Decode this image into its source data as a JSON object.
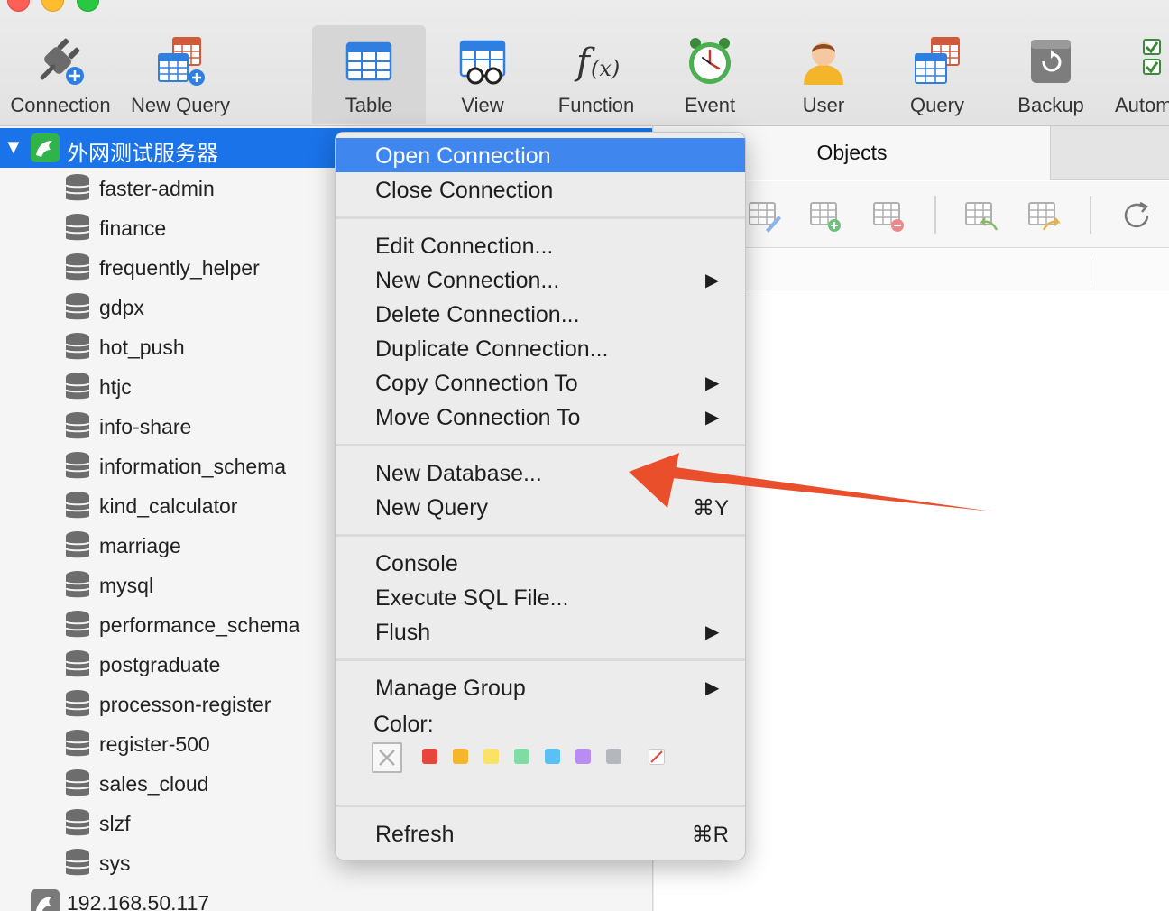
{
  "toolbar": {
    "items": [
      {
        "label": "Connection",
        "icon": "plug-add-icon"
      },
      {
        "label": "New Query",
        "icon": "new-query-icon"
      },
      {
        "label": "Table",
        "icon": "table-icon",
        "active": true
      },
      {
        "label": "View",
        "icon": "view-icon"
      },
      {
        "label": "Function",
        "icon": "function-icon"
      },
      {
        "label": "Event",
        "icon": "clock-icon"
      },
      {
        "label": "User",
        "icon": "user-icon"
      },
      {
        "label": "Query",
        "icon": "query-icon"
      },
      {
        "label": "Backup",
        "icon": "backup-icon"
      },
      {
        "label": "Autom",
        "icon": "automation-icon"
      }
    ]
  },
  "sidebar": {
    "connection": {
      "name": "外网测试服务器",
      "expanded": true
    },
    "databases": [
      "faster-admin",
      "finance",
      "frequently_helper",
      "gdpx",
      "hot_push",
      "htjc",
      "info-share",
      "information_schema",
      "kind_calculator",
      "marriage",
      "mysql",
      "performance_schema",
      "postgraduate",
      "processon-register",
      "register-500",
      "sales_cloud",
      "slzf",
      "sys"
    ],
    "connection2": {
      "name": "192.168.50.117"
    }
  },
  "right_pane": {
    "tab_label": "Objects"
  },
  "context_menu": {
    "items": [
      {
        "label": "Open Connection",
        "highlighted": true
      },
      {
        "label": "Close Connection"
      },
      {
        "label": "Edit Connection..."
      },
      {
        "label": "New Connection...",
        "submenu": true
      },
      {
        "label": "Delete Connection..."
      },
      {
        "label": "Duplicate Connection..."
      },
      {
        "label": "Copy Connection To",
        "submenu": true
      },
      {
        "label": "Move Connection To",
        "submenu": true
      },
      {
        "label": "New Database..."
      },
      {
        "label": "New Query",
        "shortcut": "⌘Y"
      },
      {
        "label": "Console"
      },
      {
        "label": "Execute SQL File..."
      },
      {
        "label": "Flush",
        "submenu": true
      },
      {
        "label": "Manage Group",
        "submenu": true
      },
      {
        "label": "Refresh",
        "shortcut": "⌘R"
      }
    ],
    "arrow_glyph": "▶",
    "color_label": "Color:",
    "colors": [
      "#e8453c",
      "#f7b52c",
      "#f9e264",
      "#7fdca4",
      "#5bc0f5",
      "#b98cf2",
      "#b4b8bd"
    ]
  },
  "annotation": {
    "color": "#ea4f2c"
  }
}
